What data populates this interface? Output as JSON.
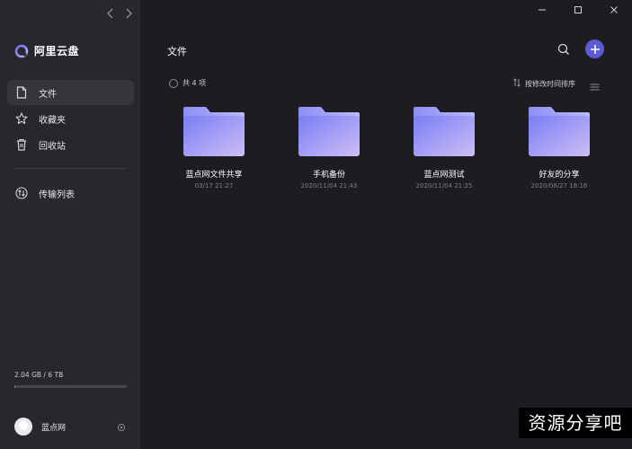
{
  "app": {
    "name": "阿里云盘"
  },
  "sidebar": {
    "items": [
      {
        "key": "files",
        "label": "文件",
        "icon": "file-icon",
        "active": true
      },
      {
        "key": "favorites",
        "label": "收藏夹",
        "icon": "star-icon",
        "active": false
      },
      {
        "key": "trash",
        "label": "回收站",
        "icon": "trash-icon",
        "active": false
      }
    ],
    "transfer": {
      "label": "传输列表",
      "icon": "transfer-icon"
    },
    "storage": {
      "text": "2.04 GB / 6 TB",
      "used_fraction": 0.0003
    },
    "user": {
      "name": "蓝点网"
    }
  },
  "main": {
    "title": "文件",
    "count_text": "共 4 项",
    "sort_label": "按修改时间排序",
    "files": [
      {
        "name": "蓝点网文件共享",
        "date": "03/17 21:27"
      },
      {
        "name": "手机备份",
        "date": "2020/11/04 21:43"
      },
      {
        "name": "蓝点网测试",
        "date": "2020/11/04 21:25"
      },
      {
        "name": "好友的分享",
        "date": "2020/08/27 18:16"
      }
    ]
  },
  "colors": {
    "accent": "#5b5bd8",
    "folder_start": "#7a7ef6",
    "folder_end": "#cdbdf5"
  },
  "watermark": "资源分享吧"
}
